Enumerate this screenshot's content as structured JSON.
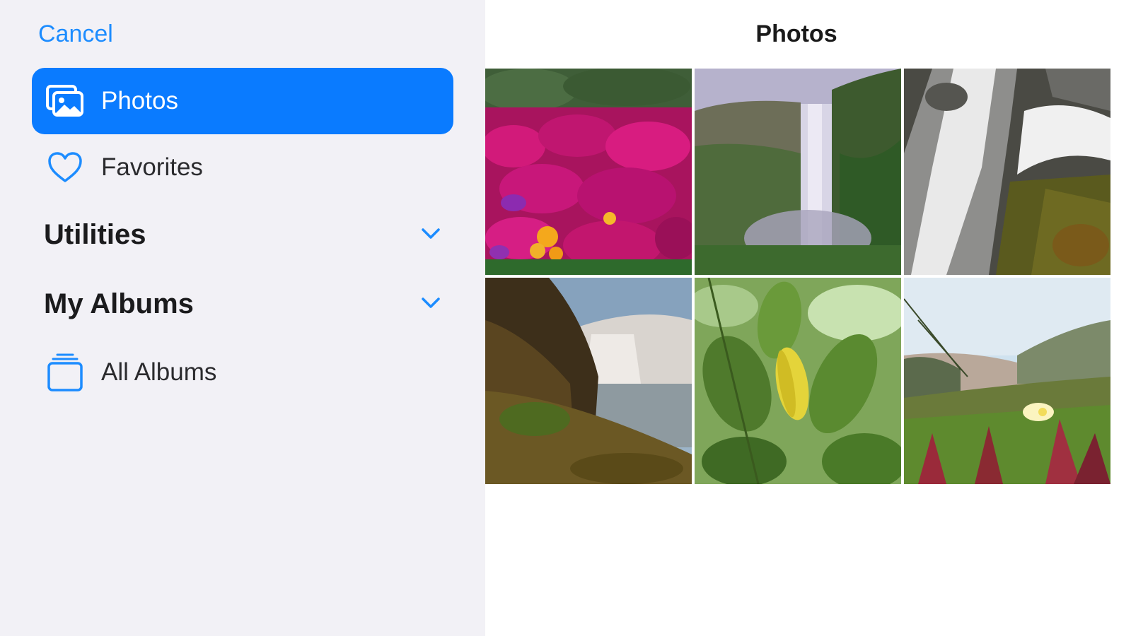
{
  "sidebar": {
    "cancel_label": "Cancel",
    "items": [
      {
        "label": "Photos",
        "icon": "photos-icon",
        "active": true
      },
      {
        "label": "Favorites",
        "icon": "heart-icon",
        "active": false
      }
    ],
    "sections": [
      {
        "title": "Utilities",
        "icon": "chevron-down-icon"
      },
      {
        "title": "My Albums",
        "icon": "chevron-down-icon"
      }
    ],
    "all_albums_label": "All Albums",
    "all_albums_icon": "albums-stack-icon"
  },
  "main": {
    "title": "Photos",
    "thumbnails": [
      {
        "name": "thumbnail-pink-flowers"
      },
      {
        "name": "thumbnail-waterfall-cliff"
      },
      {
        "name": "thumbnail-waterfall-closeup"
      },
      {
        "name": "thumbnail-waterfall-rocks"
      },
      {
        "name": "thumbnail-green-leaves"
      },
      {
        "name": "thumbnail-coastal-grass"
      }
    ]
  },
  "colors": {
    "accent": "#0a7bff",
    "link": "#1c8cff",
    "sidebar_bg": "#f2f1f6"
  }
}
